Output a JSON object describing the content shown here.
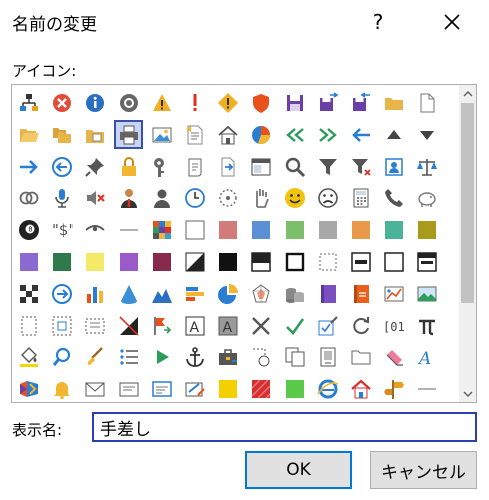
{
  "dialog": {
    "title": "名前の変更",
    "help_label": "?",
    "icons_label": "アイコン:",
    "name_label": "表示名:",
    "name_value": "手差し",
    "ok_label": "OK",
    "cancel_label": "キャンセル"
  },
  "colors": {
    "selection_border": "#3a4fb0",
    "input_border": "#2c3fb0",
    "ok_border": "#0078d7"
  },
  "icons": [
    [
      "org-chart",
      "error-circle",
      "info-circle",
      "record-circle",
      "warning-triangle",
      "exclamation-mark",
      "warning-diamond",
      "shield",
      "save-disk",
      "save-forward",
      "save-back",
      "folder",
      "blank-document"
    ],
    [
      "folder-open",
      "folder-pair",
      "folder-doc",
      "printer",
      "picture",
      "document-lines",
      "house",
      "pie-chart",
      "double-left-arrow",
      "double-right-arrow",
      "left-arrow",
      "up-triangle",
      "down-triangle"
    ],
    [
      "right-arrow",
      "circle-left-arrow",
      "pushpin",
      "padlock",
      "key",
      "scroll",
      "document-arrow",
      "window",
      "magnifier",
      "filter",
      "filter-x",
      "address-book",
      "scales"
    ],
    [
      "two-rings",
      "microphone",
      "mute-speaker",
      "person-tie",
      "person",
      "clock",
      "dotted-circle",
      "hand",
      "smiley",
      "sad-face",
      "calculator",
      "phone",
      "piggy-bank"
    ],
    [
      "eight-ball",
      "dollar-quote",
      "eye",
      "line",
      "color-grid",
      "white-square",
      "salmon-square",
      "blue-square",
      "green-square",
      "gray-square",
      "orange-square",
      "teal-square",
      "olive-square"
    ],
    [
      "purple-square",
      "dark-green-square",
      "yellow-square",
      "violet-square",
      "maroon-square",
      "diagonal-square",
      "black-square",
      "half-black-square",
      "outlined-square",
      "dashed-square",
      "bar-square",
      "outline-square-2",
      "top-bar-square"
    ],
    [
      "checker-square",
      "circle-right-arrow",
      "bar-chart",
      "cone",
      "mountain",
      "stack-bars",
      "pie-slice",
      "radar-web",
      "cylinders",
      "book",
      "orange-book",
      "chart-picture",
      "landscape-picture"
    ],
    [
      "dashed-page",
      "dashed-photo",
      "dashed-film",
      "diagonal-image",
      "flag-arrows",
      "letter-a-boxed",
      "letter-a-gray",
      "x-mark",
      "check-mark",
      "checkbox-pen",
      "circular-arrows",
      "bracket-number",
      "pi"
    ],
    [
      "paint-bucket",
      "search-zoom",
      "brush",
      "bullet-list",
      "play-triangle",
      "anchor",
      "toolbox",
      "selection-circle",
      "copy-pages",
      "phone-page",
      "open-folder-outline",
      "eraser",
      "letter-a-italic"
    ],
    [
      "office-logo",
      "bell",
      "envelope",
      "card",
      "id-card",
      "pen-card",
      "yellow-square-2",
      "red-stripes",
      "green-square-2",
      "ie-globe",
      "house-red",
      "signpost",
      "horizontal-line"
    ]
  ]
}
